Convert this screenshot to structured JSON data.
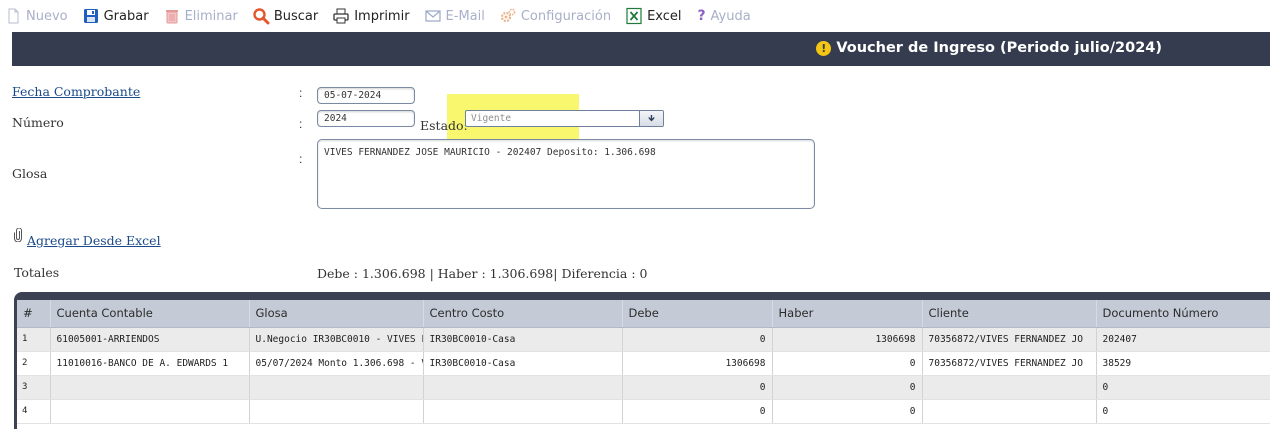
{
  "toolbar": {
    "nuevo": "Nuevo",
    "grabar": "Grabar",
    "eliminar": "Eliminar",
    "buscar": "Buscar",
    "imprimir": "Imprimir",
    "email": "E-Mail",
    "configuracion": "Configuración",
    "excel": "Excel",
    "ayuda": "Ayuda"
  },
  "header": {
    "title": "Voucher de Ingreso (Periodo julio/2024)"
  },
  "form": {
    "fecha_label": "Fecha Comprobante",
    "fecha_value": "05-07-2024",
    "numero_label": "Número",
    "numero_value": "2024",
    "estado_label": "Estado:",
    "estado_value": "Vigente",
    "glosa_label": "Glosa",
    "glosa_value": "VIVES FERNANDEZ JOSE MAURICIO - 202407 Deposito: 1.306.698",
    "colon": ":"
  },
  "agregar_link": "Agregar Desde Excel",
  "totales": {
    "label": "Totales",
    "text": "Debe : 1.306.698 | Haber : 1.306.698| Diferencia : 0"
  },
  "grid": {
    "columns": [
      "#",
      "Cuenta Contable",
      "Glosa",
      "Centro Costo",
      "Debe",
      "Haber",
      "Cliente",
      "Documento Número"
    ],
    "rows": [
      [
        "1",
        "61005001-ARRIENDOS",
        "U.Negocio IR30BC0010 - VIVES F",
        "IR30BC0010-Casa",
        "0",
        "1306698",
        "70356872/VIVES FERNANDEZ JO",
        "202407"
      ],
      [
        "2",
        "11010016-BANCO DE A. EDWARDS 1",
        "05/07/2024 Monto 1.306.698 - V",
        "IR30BC0010-Casa",
        "1306698",
        "0",
        "70356872/VIVES FERNANDEZ JO",
        "38529"
      ],
      [
        "3",
        "",
        "",
        "",
        "0",
        "0",
        "",
        "0"
      ],
      [
        "4",
        "",
        "",
        "",
        "0",
        "0",
        "",
        "0"
      ]
    ]
  },
  "colors": {
    "header_bg": "#353c4f",
    "highlight": "#f6f54d",
    "link": "#1a4a8a",
    "grid_header": "#c4cad6"
  }
}
